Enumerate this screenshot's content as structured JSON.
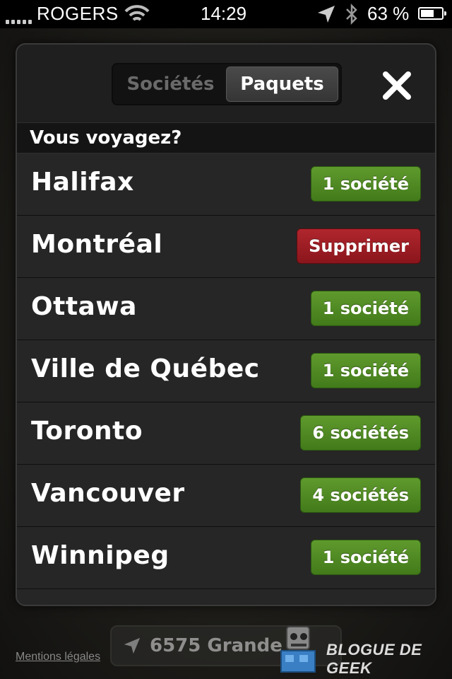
{
  "status_bar": {
    "carrier": "ROGERS",
    "time": "14:29",
    "battery_percent": "63 %",
    "battery_level": 0.63,
    "icons": [
      "signal-icon",
      "wifi-icon",
      "location-arrow-icon",
      "bluetooth-icon",
      "battery-icon"
    ]
  },
  "segmented": {
    "tabs": [
      {
        "label": "Sociétés",
        "active": false
      },
      {
        "label": "Paquets",
        "active": true
      }
    ]
  },
  "close_icon": "close-icon",
  "section": {
    "title": "Vous voyagez?"
  },
  "destinations": [
    {
      "city": "Halifax",
      "badge": "1 société",
      "badge_color": "#4f8a22"
    },
    {
      "city": "Montréal",
      "badge": "Supprimer",
      "badge_color": "#9d1b22"
    },
    {
      "city": "Ottawa",
      "badge": "1 société",
      "badge_color": "#4f8a22"
    },
    {
      "city": "Ville de Québec",
      "badge": "1 société",
      "badge_color": "#4f8a22"
    },
    {
      "city": "Toronto",
      "badge": "6 sociétés",
      "badge_color": "#4f8a22"
    },
    {
      "city": "Vancouver",
      "badge": "4 sociétés",
      "badge_color": "#4f8a22"
    },
    {
      "city": "Winnipeg",
      "badge": "1 société",
      "badge_color": "#4f8a22"
    }
  ],
  "footer": {
    "address": "6575 Grande",
    "legal_link": "Mentions légales",
    "watermark_text": "BLOGUE DE GEEK"
  },
  "colors": {
    "accent_green": "#4f8a22",
    "delete_red": "#9d1b22",
    "panel_bg": "#1f1f1f"
  }
}
